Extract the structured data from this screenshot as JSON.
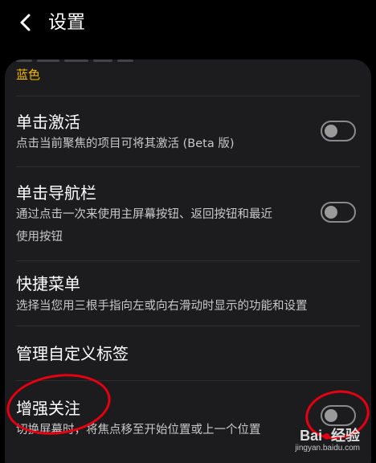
{
  "header": {
    "title": "设置"
  },
  "previous_item": {
    "value": "蓝色"
  },
  "rows": [
    {
      "title": "单击激活",
      "subtitle": "点击当前聚焦的项目可将其激活 (Beta 版)",
      "toggle": "off"
    },
    {
      "title": "单击导航栏",
      "subtitle_line1": "通过点击一次来使用主屏幕按钮、返回按钮和最近",
      "subtitle_line2": "使用按钮",
      "toggle": "off"
    },
    {
      "title": "快捷菜单",
      "subtitle": "选择当您用三根手指向左或向右滑动时显示的功能和设置"
    },
    {
      "title": "管理自定义标签"
    },
    {
      "title": "增强关注",
      "subtitle": "切换屏幕时，将焦点移至开始位置或上一个位置",
      "toggle": "off"
    }
  ],
  "colors": {
    "accent": "#f5b700",
    "annotation": "#e60012",
    "background": "#000000",
    "card": "#1c1c1e"
  },
  "watermark": {
    "brand": "Bai",
    "brand2": "经验",
    "url": "jingyan.baidu.com"
  }
}
